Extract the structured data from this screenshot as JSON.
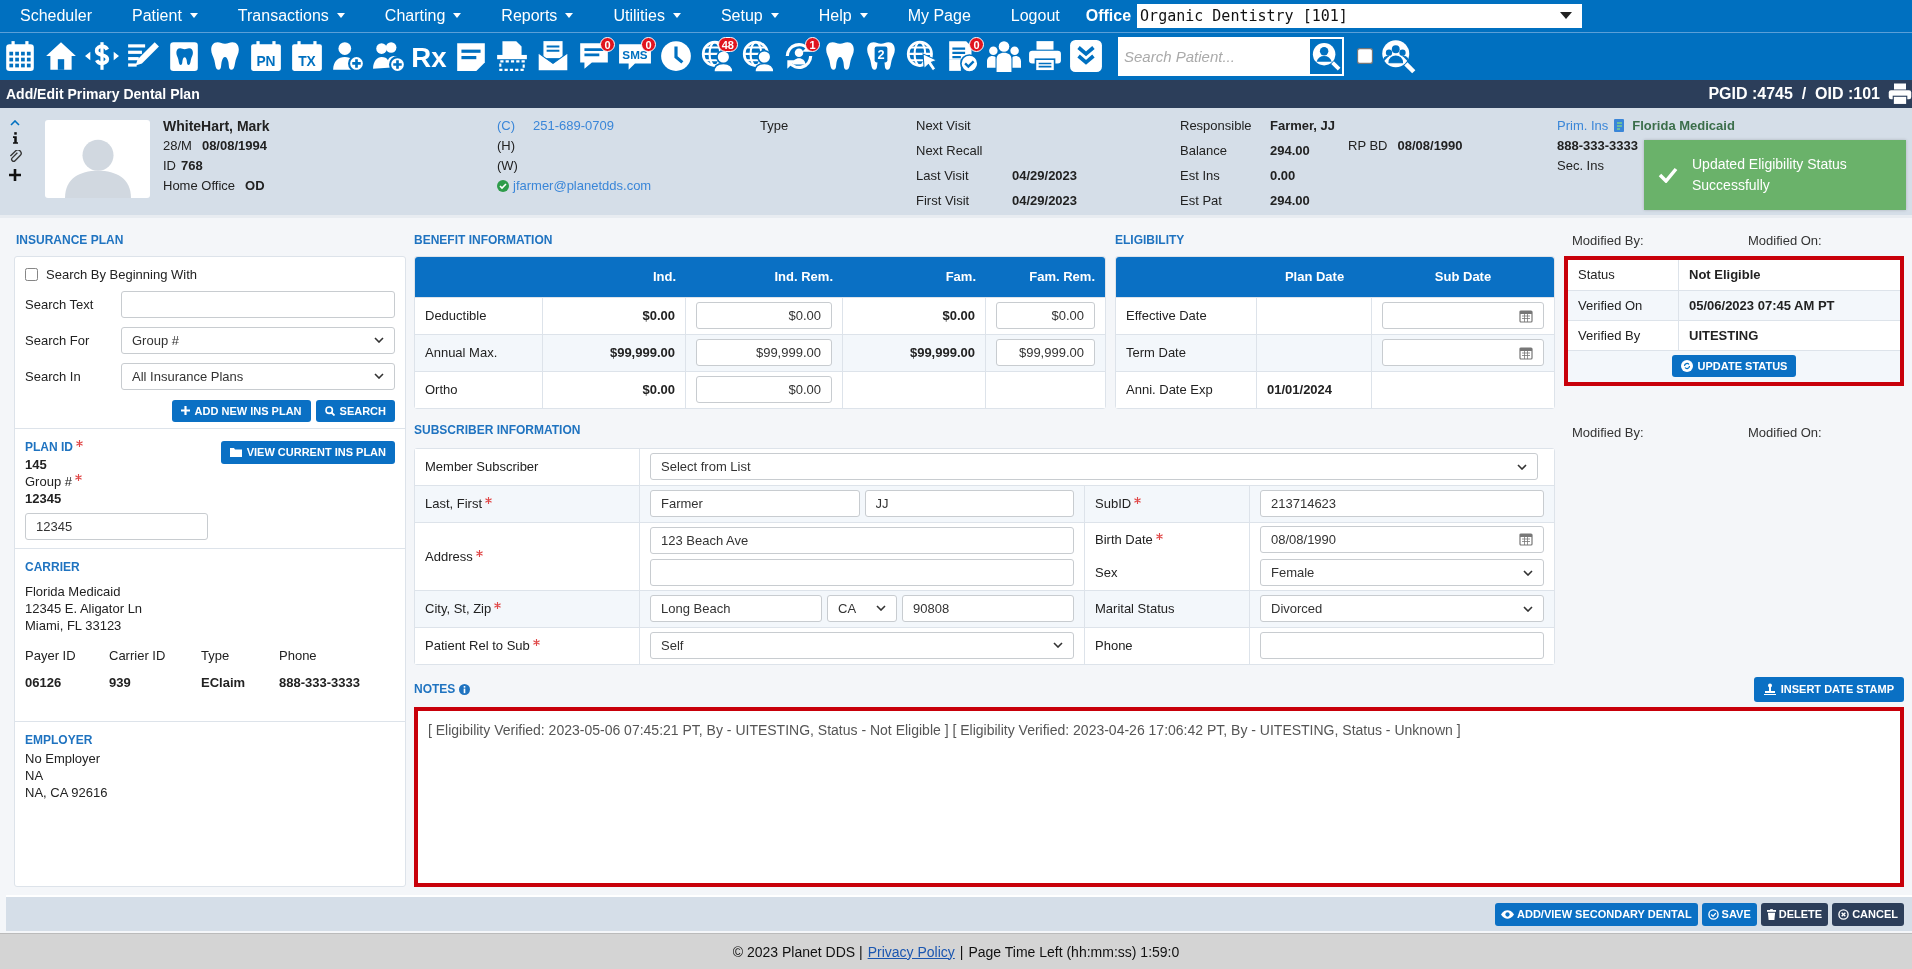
{
  "menu": [
    {
      "label": "Scheduler",
      "dropdown": false
    },
    {
      "label": "Patient",
      "dropdown": true
    },
    {
      "label": "Transactions",
      "dropdown": true
    },
    {
      "label": "Charting",
      "dropdown": true
    },
    {
      "label": "Reports",
      "dropdown": true
    },
    {
      "label": "Utilities",
      "dropdown": true
    },
    {
      "label": "Setup",
      "dropdown": true
    },
    {
      "label": "Help",
      "dropdown": true
    },
    {
      "label": "My Page",
      "dropdown": false
    },
    {
      "label": "Logout",
      "dropdown": false
    }
  ],
  "office": {
    "label": "Office",
    "value": "Organic Dentistry [101]"
  },
  "toolbar": {
    "items": [
      {
        "kind": "calendar"
      },
      {
        "kind": "home"
      },
      {
        "kind": "dollar"
      },
      {
        "kind": "edit"
      },
      {
        "kind": "tooth-card"
      },
      {
        "kind": "tooth"
      },
      {
        "kind": "doc-label",
        "label": "PN"
      },
      {
        "kind": "doc-label",
        "label": "TX"
      },
      {
        "kind": "person-add"
      },
      {
        "kind": "group-add"
      },
      {
        "kind": "rx",
        "label": "Rx"
      },
      {
        "kind": "note"
      },
      {
        "kind": "scan"
      },
      {
        "kind": "mail"
      },
      {
        "kind": "chat",
        "badge": "0"
      },
      {
        "kind": "bubble-label",
        "label": "SMS",
        "badge": "0"
      },
      {
        "kind": "clock"
      },
      {
        "kind": "globe-user",
        "badge": "48"
      },
      {
        "kind": "globe-user"
      },
      {
        "kind": "sync-user",
        "badge": "1"
      },
      {
        "kind": "tooth"
      },
      {
        "kind": "tooth-label",
        "label": "2"
      },
      {
        "kind": "globe-cursor"
      },
      {
        "kind": "doc-check",
        "badge": "0"
      },
      {
        "kind": "group"
      },
      {
        "kind": "printer"
      },
      {
        "kind": "chevrons"
      }
    ],
    "search": {
      "placeholder": "Search Patient..."
    },
    "checkbox": {
      "checked": false
    }
  },
  "title_bar": {
    "title": "Add/Edit Primary Dental Plan",
    "ids": "PGID :4745  /  OID :101"
  },
  "patient": {
    "name": "WhiteHart, Mark",
    "age_sex": "28/M",
    "dob": "08/08/1994",
    "id_label": "ID",
    "id": "768",
    "office_label": "Home Office",
    "office": "OD",
    "phones": [
      {
        "label": "(C)",
        "number": "251-689-0709"
      },
      {
        "label": "(H)"
      },
      {
        "label": "(W)"
      }
    ],
    "email": "jfarmer@planetdds.com",
    "email_verified": true,
    "type_label": "Type",
    "visits": [
      {
        "label": "Next Visit"
      },
      {
        "label": "Next Recall"
      },
      {
        "label": "Last Visit",
        "value": "04/29/2023"
      },
      {
        "label": "First Visit",
        "value": "04/29/2023"
      }
    ],
    "account": [
      {
        "label": "Responsible",
        "value": "Farmer, JJ"
      },
      {
        "label": "Balance",
        "value": "294.00"
      },
      {
        "label": "Est Ins",
        "value": "0.00"
      },
      {
        "label": "Est Pat",
        "value": "294.00"
      }
    ],
    "rp_bd": {
      "label": "RP BD",
      "value": "08/08/1990"
    },
    "insurance": {
      "primary_label": "Prim. Ins",
      "primary_name": "Florida Medicaid",
      "primary_phone": "888-333-3333",
      "secondary_label": "Sec. Ins"
    }
  },
  "toast": {
    "message": "Updated Eligibility Status Successfully"
  },
  "insurance_plan": {
    "title": "INSURANCE PLAN",
    "search_beginning": {
      "label": "Search By Beginning With",
      "checked": false
    },
    "fields": [
      {
        "label": "Search Text",
        "kind": "text"
      },
      {
        "label": "Search For",
        "kind": "select",
        "value": "Group #"
      },
      {
        "label": "Search In",
        "kind": "select",
        "value": "All Insurance Plans"
      }
    ],
    "buttons": [
      {
        "label": "ADD NEW INS PLAN",
        "kind": "add"
      },
      {
        "label": "SEARCH",
        "kind": "search"
      }
    ],
    "plan_id_label": "PLAN ID",
    "plan_id": "145",
    "group_label": "Group #",
    "group": "12345",
    "group_input": "12345",
    "view_button": "VIEW CURRENT INS PLAN"
  },
  "carrier": {
    "title": "CARRIER",
    "lines": [
      "Florida Medicaid",
      "12345 E. Aligator Ln",
      "Miami, FL 33123"
    ],
    "details": [
      {
        "label": "Payer ID",
        "value": "06126"
      },
      {
        "label": "Carrier ID",
        "value": "939"
      },
      {
        "label": "Type",
        "value": "EClaim"
      },
      {
        "label": "Phone",
        "value": "888-333-3333"
      }
    ]
  },
  "employer": {
    "title": "EMPLOYER",
    "lines": [
      "No Employer",
      "NA",
      "NA, CA 92616"
    ]
  },
  "benefit": {
    "title": "BENEFIT INFORMATION",
    "columns": [
      "Ind.",
      "Ind. Rem.",
      "Fam.",
      "Fam. Rem."
    ],
    "rows": [
      {
        "label": "Deductible",
        "ind": "$0.00",
        "ind_rem": "$0.00",
        "fam": "$0.00",
        "fam_rem": "$0.00"
      },
      {
        "label": "Annual Max.",
        "ind": "$99,999.00",
        "ind_rem": "$99,999.00",
        "fam": "$99,999.00",
        "fam_rem": "$99,999.00"
      },
      {
        "label": "Ortho",
        "ind": "$0.00",
        "ind_rem": "$0.00"
      }
    ]
  },
  "eligibility": {
    "title": "ELIGIBILITY",
    "columns": [
      "Plan Date",
      "Sub Date"
    ],
    "rows": [
      {
        "label": "Effective Date",
        "kind": "date"
      },
      {
        "label": "Term Date",
        "kind": "date"
      },
      {
        "label": "Anni. Date Exp",
        "kind": "text",
        "plan_date": "01/01/2024"
      }
    ]
  },
  "status": {
    "modified_by": "Modified By:",
    "modified_on": "Modified On:",
    "highlighted": true,
    "rows": [
      {
        "label": "Status",
        "value": "Not Eligible"
      },
      {
        "label": "Verified On",
        "value": "05/06/2023 07:45 AM PT"
      },
      {
        "label": "Verified By",
        "value": "UITESTING"
      }
    ],
    "button": "UPDATE STATUS"
  },
  "subscriber_audit": {
    "modified_by": "Modified By:",
    "modified_on": "Modified On:"
  },
  "subscriber": {
    "title": "SUBSCRIBER INFORMATION",
    "member": {
      "label": "Member Subscriber",
      "value": "Select from List"
    },
    "rows": [
      {
        "label": "Last, First",
        "required": true,
        "fields": [
          [
            {
              "kind": "text",
              "value": "Farmer"
            },
            {
              "kind": "text",
              "value": "JJ"
            }
          ]
        ],
        "side": [
          {
            "label": "SubID",
            "required": true,
            "field": {
              "kind": "text",
              "value": "213714623"
            }
          }
        ]
      },
      {
        "label": "Address",
        "required": true,
        "fields": [
          [
            {
              "kind": "text",
              "value": "123 Beach Ave"
            }
          ],
          [
            {
              "kind": "text"
            }
          ]
        ],
        "side": [
          {
            "label": "Birth Date",
            "required": true,
            "field": {
              "kind": "date",
              "value": "08/08/1990"
            }
          },
          {
            "label": "Sex",
            "required": false,
            "field": {
              "kind": "select",
              "value": "Female"
            }
          }
        ]
      },
      {
        "label": "City, St, Zip",
        "required": true,
        "fields": [
          [
            {
              "kind": "text",
              "value": "Long Beach"
            },
            {
              "kind": "select",
              "value": "CA"
            },
            {
              "kind": "text",
              "value": "90808"
            }
          ]
        ],
        "side": [
          {
            "label": "Marital Status",
            "required": false,
            "field": {
              "kind": "select",
              "value": "Divorced"
            }
          }
        ]
      },
      {
        "label": "Patient Rel to Sub",
        "required": true,
        "fields": [
          [
            {
              "kind": "select",
              "value": "Self"
            }
          ]
        ],
        "side": [
          {
            "label": "Phone",
            "required": false,
            "field": {
              "kind": "text"
            }
          }
        ]
      }
    ]
  },
  "notes": {
    "title": "NOTES",
    "button": "INSERT DATE STAMP",
    "highlighted": true,
    "text": "[ Eligibility Verified: 2023-05-06 07:45:21 PT, By - UITESTING, Status - Not Eligible ] [ Eligibility Verified: 2023-04-26 17:06:42 PT, By - UITESTING, Status - Unknown ]"
  },
  "actions": [
    {
      "label": "ADD/VIEW SECONDARY DENTAL",
      "kind": "view"
    },
    {
      "label": "SAVE",
      "kind": "save"
    },
    {
      "label": "DELETE",
      "kind": "delete"
    },
    {
      "label": "CANCEL",
      "kind": "cancel"
    }
  ],
  "footer": {
    "copyright": "© 2023 Planet DDS |",
    "link": "Privacy Policy",
    "separator": "|",
    "time_left": "Page Time Left (hh:mm:ss) 1:59:0"
  }
}
